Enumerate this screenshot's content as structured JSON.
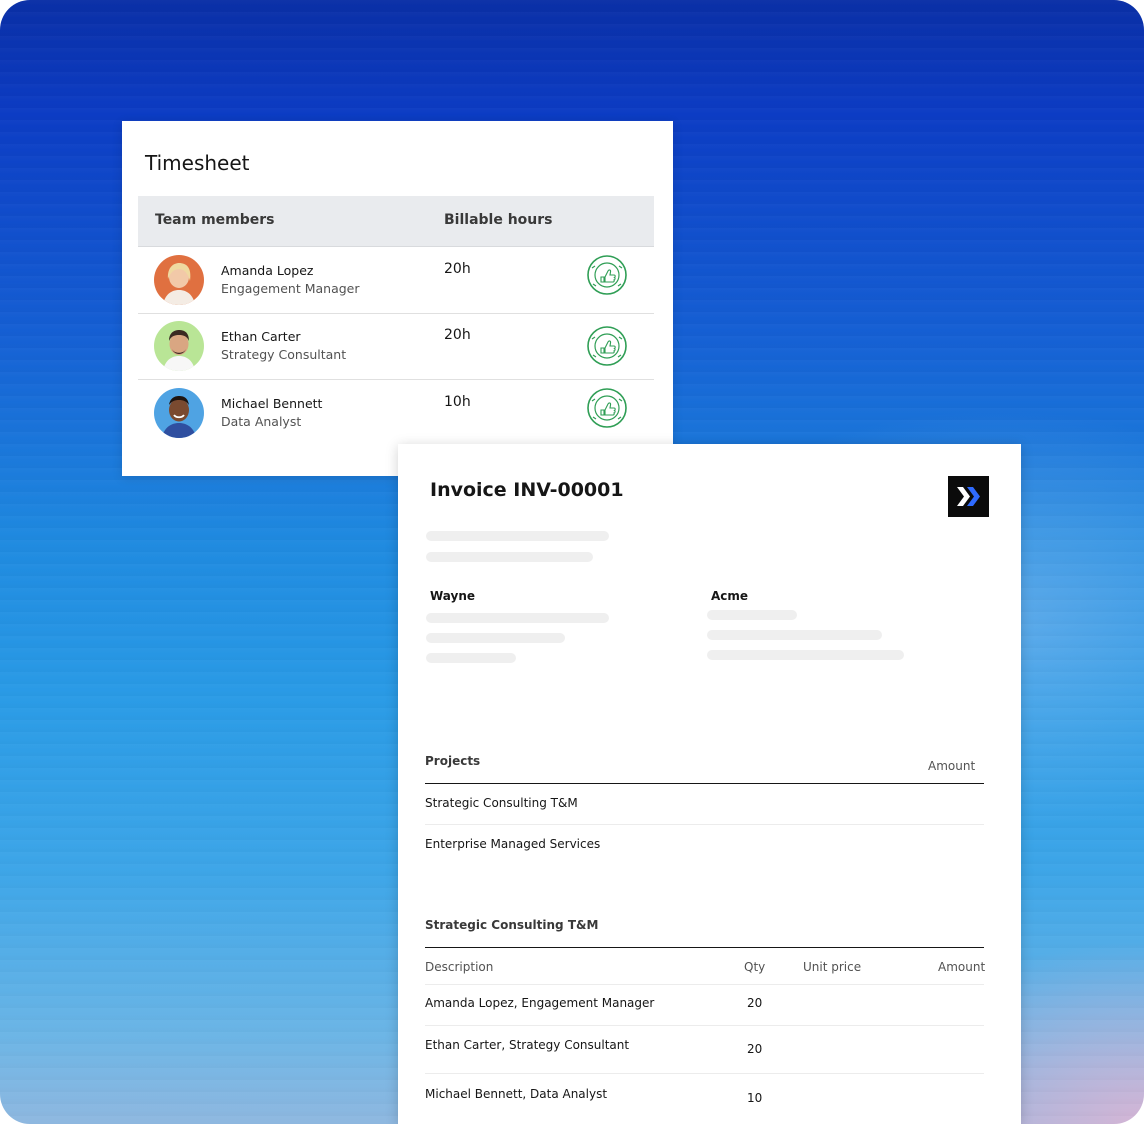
{
  "timesheet": {
    "title": "Timesheet",
    "columns": {
      "members": "Team members",
      "hours": "Billable hours"
    },
    "rows": [
      {
        "name": "Amanda Lopez",
        "role": "Engagement Manager",
        "hours": "20h",
        "avatar_bg": "#e07040",
        "status_icon": "approved-stamp-icon"
      },
      {
        "name": "Ethan Carter",
        "role": "Strategy Consultant",
        "hours": "20h",
        "avatar_bg": "#b9e596",
        "status_icon": "approved-stamp-icon"
      },
      {
        "name": "Michael Bennett",
        "role": "Data Analyst",
        "hours": "10h",
        "avatar_bg": "#4fa3e3",
        "status_icon": "approved-stamp-icon"
      }
    ]
  },
  "invoice": {
    "title": "Invoice INV-00001",
    "logo_icon": "double-chevron-logo-icon",
    "from": "Wayne",
    "to": "Acme",
    "projects": {
      "heading": "Projects",
      "amount_label": "Amount",
      "items": [
        "Strategic Consulting T&M",
        "Enterprise Managed Services"
      ]
    },
    "detail": {
      "heading": "Strategic Consulting T&M",
      "columns": {
        "description": "Description",
        "qty": "Qty",
        "unit_price": "Unit price",
        "amount": "Amount"
      },
      "rows": [
        {
          "description": "Amanda Lopez, Engagement Manager",
          "qty": "20"
        },
        {
          "description": "Ethan Carter, Strategy Consultant",
          "qty": "20"
        },
        {
          "description": "Michael Bennett, Data Analyst",
          "qty": "10"
        }
      ]
    }
  },
  "colors": {
    "stamp_green": "#2f9e55",
    "logo_bg": "#0b0b0b",
    "logo_accent": "#2f6bff"
  }
}
